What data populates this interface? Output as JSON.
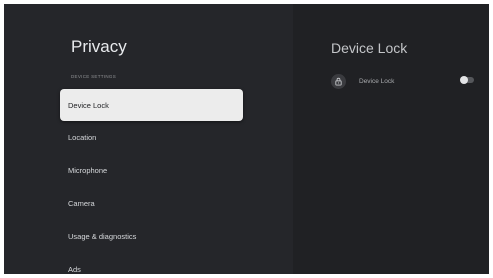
{
  "privacy": {
    "title": "Privacy",
    "section_label": "DEVICE SETTINGS",
    "items": [
      {
        "label": "Device Lock",
        "focused": true
      },
      {
        "label": "Location"
      },
      {
        "label": "Microphone"
      },
      {
        "label": "Camera"
      },
      {
        "label": "Usage & diagnostics"
      },
      {
        "label": "Ads"
      }
    ]
  },
  "detail": {
    "title": "Device Lock",
    "option": {
      "label": "Device Lock",
      "icon": "lock-icon",
      "toggle_on": false
    }
  },
  "colors": {
    "background": "#202124",
    "left_panel": "#25262a",
    "focused_item": "#ececec"
  }
}
